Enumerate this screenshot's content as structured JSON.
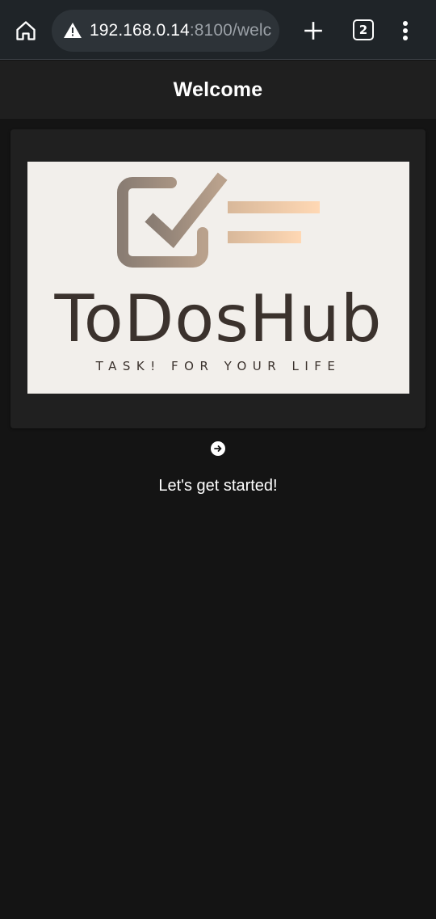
{
  "browser": {
    "url_host": "192.168.0.14",
    "url_rest": ":8100/welc",
    "tab_count": "2",
    "icons": [
      "home-icon",
      "warning-icon",
      "plus-icon",
      "tab-switcher-icon",
      "more-vert-icon"
    ]
  },
  "header": {
    "title": "Welcome"
  },
  "logo": {
    "brand": "ToDosHub",
    "tagline": "TASK! FOR YOUR LIFE",
    "colors": {
      "text": "#3b322d",
      "background": "#f2efeb",
      "gradient_start": "#8a7d73",
      "gradient_end": "#ffd8b4"
    }
  },
  "main": {
    "cta_icon": "arrow-right-circle-icon",
    "cta_text": "Let's get started!"
  },
  "theme": {
    "background": "#141414",
    "header_bg": "#1f1f1f",
    "card_bg": "#202020"
  }
}
